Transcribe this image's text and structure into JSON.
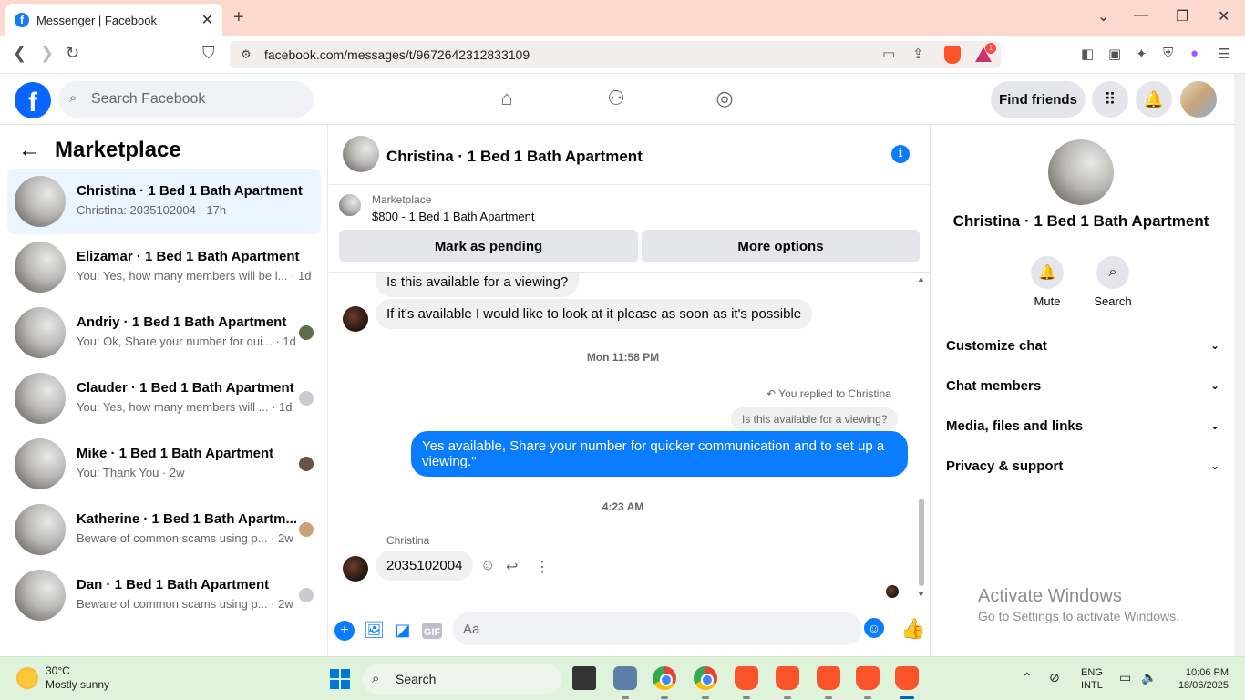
{
  "browser": {
    "tab_title": "Messenger | Facebook",
    "tab_close": "✕",
    "new_tab": "+",
    "url": "facebook.com/messages/t/9672642312833109",
    "badge_count": "1"
  },
  "fb_header": {
    "logo": "f",
    "search_placeholder": "Search Facebook",
    "find_friends": "Find friends"
  },
  "left": {
    "title": "Marketplace",
    "conversations": [
      {
        "title": "Christina · 1 Bed 1 Bath Apartment",
        "sub": "Christina: 2035102004 · 17h",
        "active": true
      },
      {
        "title": "Elizamar · 1 Bed 1 Bath Apartment",
        "sub": "You: Yes, how many members will be l... · 1d"
      },
      {
        "title": "Andriy · 1 Bed 1 Bath Apartment",
        "sub": "You: Ok, Share your number for qui... · 1d"
      },
      {
        "title": "Clauder · 1 Bed 1 Bath Apartment",
        "sub": "You: Yes, how many members will ... · 1d"
      },
      {
        "title": "Mike · 1 Bed 1 Bath Apartment",
        "sub": "You: Thank You · 2w"
      },
      {
        "title": "Katherine · 1 Bed 1 Bath Apartm...",
        "sub": "Beware of common scams using p... · 2w"
      },
      {
        "title": "Dan · 1 Bed 1 Bath Apartment",
        "sub": "Beware of common scams using p... · 2w"
      }
    ]
  },
  "chat": {
    "title": "Christina · 1 Bed 1 Bath Apartment",
    "info_icon": "i",
    "listing": {
      "category": "Marketplace",
      "price_title": "$800 - 1 Bed 1 Bath Apartment",
      "btn_pending": "Mark as pending",
      "btn_more": "More options"
    },
    "messages": {
      "m1": "Is this available for a viewing?",
      "m2": "If it's available I would like to look at it please as soon as it's possible",
      "stamp1": "Mon 11:58 PM",
      "reply_label": "You replied to Christina",
      "quoted": "Is this available for a viewing?",
      "m3": "Yes available, Share your number for quicker communication and to set up a viewing.\"",
      "stamp2": "4:23 AM",
      "sender": "Christina",
      "m4": "2035102004"
    },
    "composer_placeholder": "Aa"
  },
  "right": {
    "title": "Christina · 1 Bed 1 Bath Apartment",
    "actions": {
      "mute": "Mute",
      "search": "Search"
    },
    "sections": [
      "Customize chat",
      "Chat members",
      "Media, files and links",
      "Privacy & support"
    ],
    "watermark_1": "Activate Windows",
    "watermark_2": "Go to Settings to activate Windows."
  },
  "taskbar": {
    "temp": "30°C",
    "weather": "Mostly sunny",
    "search": "Search",
    "lang_1": "ENG",
    "lang_2": "INTL",
    "time": "10:06 PM",
    "date": "18/06/2025"
  }
}
